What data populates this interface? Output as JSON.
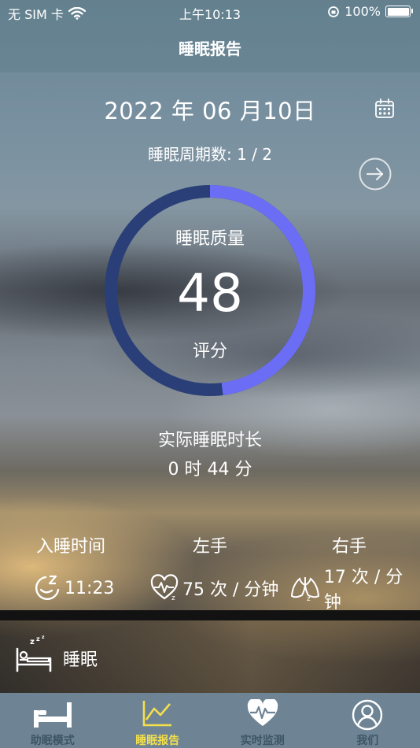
{
  "status_bar": {
    "carrier": "无 SIM 卡",
    "time": "上午10:13",
    "battery": "100%",
    "battery_level": 1.0
  },
  "nav": {
    "title": "睡眠报告"
  },
  "report": {
    "date": "2022 年 06 月10日",
    "cycle_text": "睡眠周期数: 1 / 2",
    "quality_label": "睡眠质量",
    "score": "48",
    "score_value": 48,
    "score_unit": "评分",
    "duration_label": "实际睡眠时长",
    "duration_value": "0 时 44 分"
  },
  "stats": {
    "sleep_time_label": "入睡时间",
    "sleep_time_value": "11:23",
    "left_label": "左手",
    "left_value": "75 次 / 分钟",
    "right_label": "右手",
    "right_value": "17 次 / 分钟"
  },
  "sleep_row": {
    "label": "睡眠"
  },
  "tabs": [
    {
      "label": "助眠模式",
      "icon": "bed-icon"
    },
    {
      "label": "睡眠报告",
      "icon": "chart-icon"
    },
    {
      "label": "实时监测",
      "icon": "heart-monitor-icon"
    },
    {
      "label": "我们",
      "icon": "person-icon"
    }
  ],
  "colors": {
    "ring_progress": "#6b6ef5",
    "ring_track": "#2a3f78",
    "tab_active": "#f4e04a",
    "tab_inactive": "#3e5566",
    "tab_bg": "#6e8494"
  }
}
